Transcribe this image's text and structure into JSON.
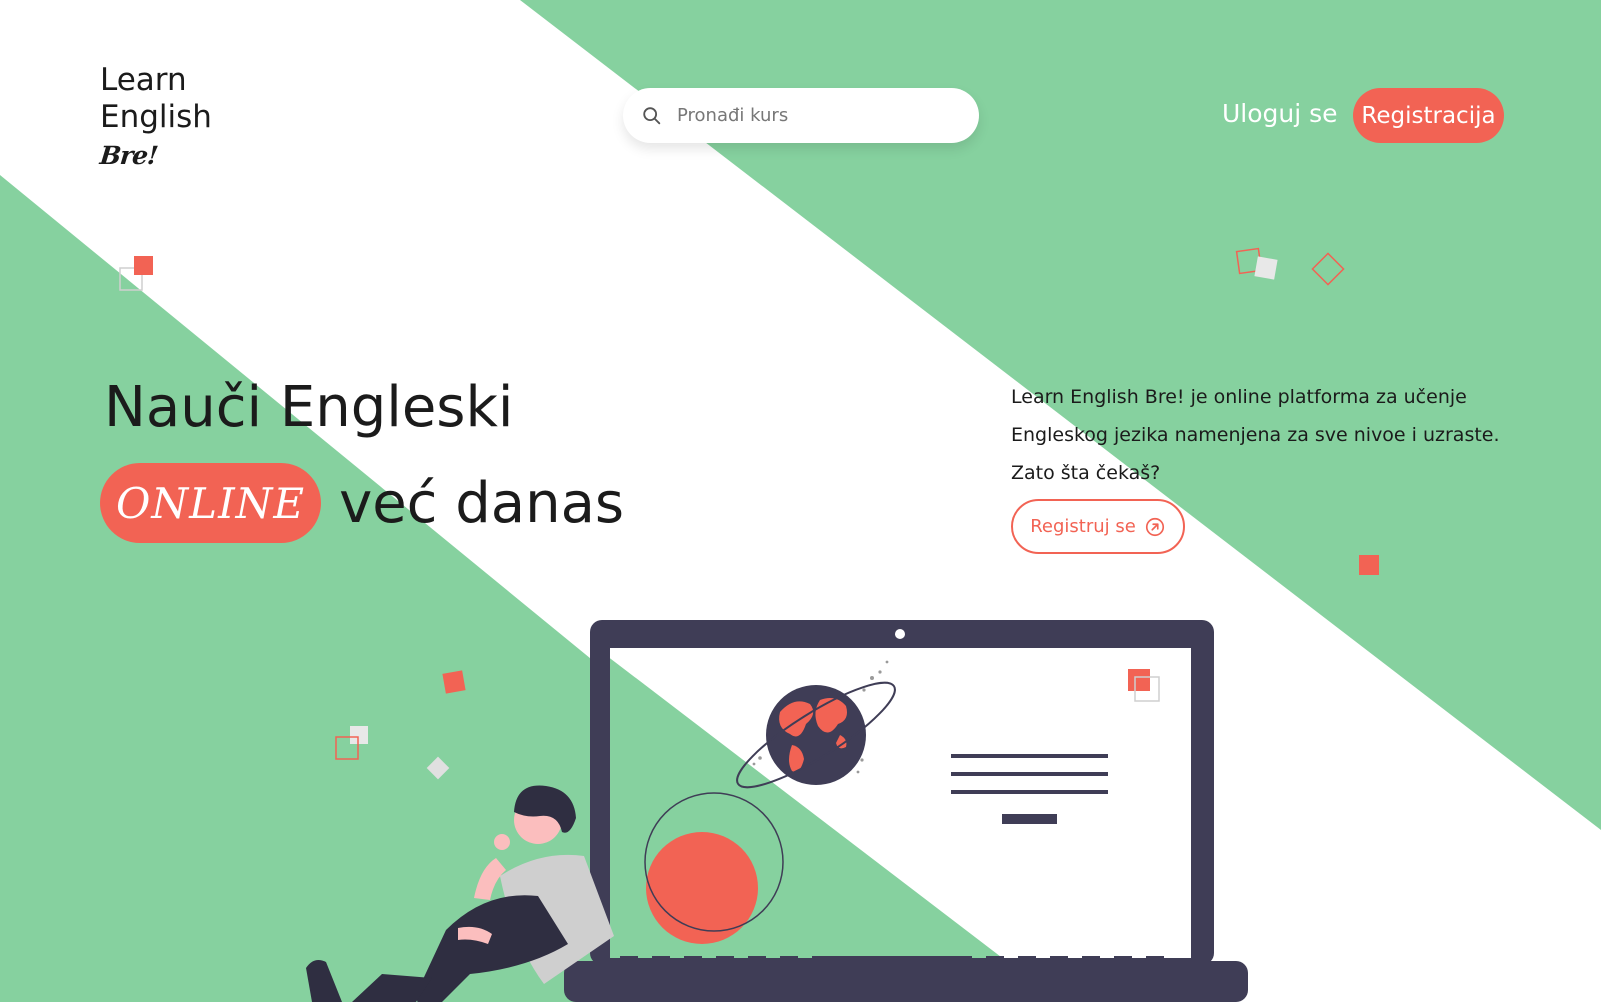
{
  "brand": {
    "line1": "Learn",
    "line2": "English",
    "line3": "Bre!"
  },
  "search": {
    "placeholder": "Pronađi kurs",
    "icon": "search-icon"
  },
  "nav": {
    "login_label": "Uloguj se",
    "register_label": "Registracija"
  },
  "hero": {
    "title_line1": "Nauči Engleski",
    "highlight": "ONLINE",
    "title_rest": "već danas"
  },
  "intro": {
    "text": "Learn English Bre! je online platforma za učenje Engleskog jezika namenjena za sve nivoe i uzraste. Zato šta čekaš?",
    "cta_label": "Registruj se",
    "cta_icon": "arrow-up-right-circle-icon"
  },
  "colors": {
    "accent": "#f26354",
    "green": "#86d19f",
    "dark": "#3f3d56"
  }
}
